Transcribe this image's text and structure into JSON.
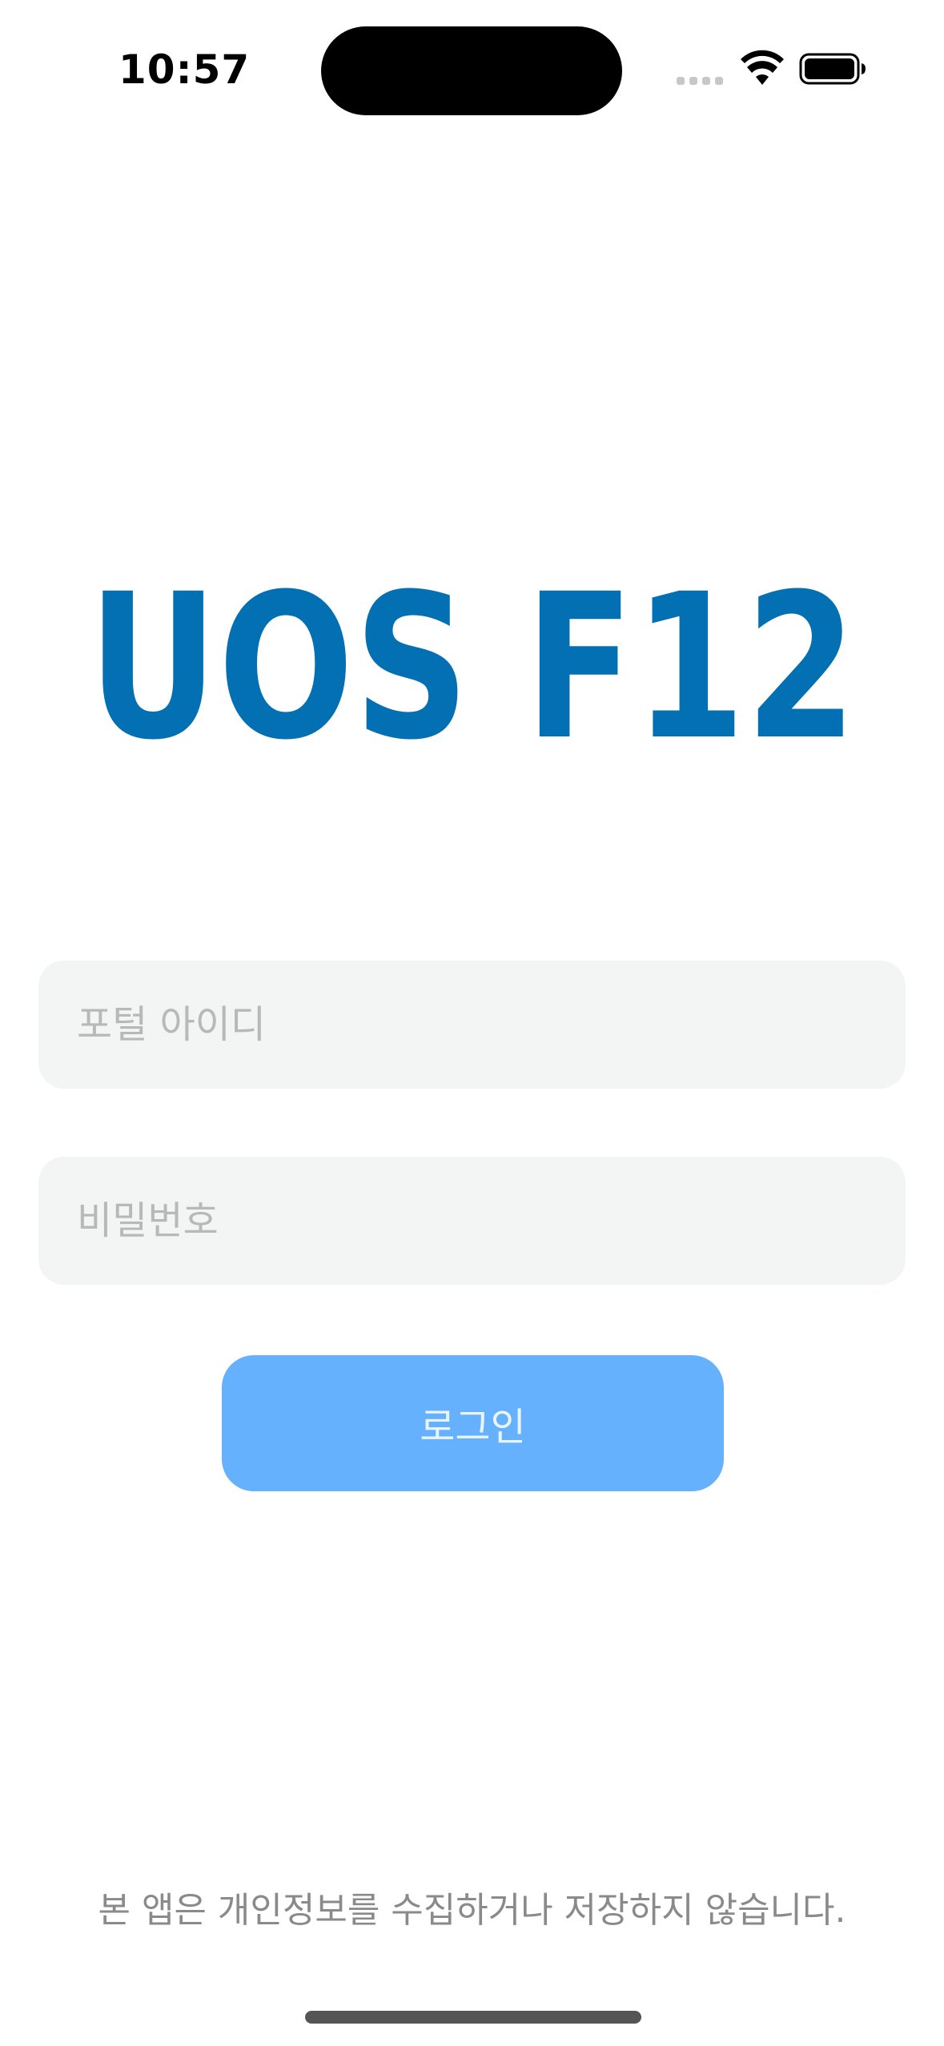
{
  "status_bar": {
    "time": "10:57",
    "icons": [
      "signal-icon",
      "wifi-icon",
      "battery-icon"
    ]
  },
  "logo": {
    "text": "UOS F12",
    "color": "#0270b2"
  },
  "login_form": {
    "id_placeholder": "포털 아이디",
    "id_value": "",
    "password_placeholder": "비밀번호",
    "password_value": "",
    "login_label": "로그인"
  },
  "footer": {
    "privacy_notice": "본 앱은 개인정보를 수집하거나 저장하지 않습니다."
  },
  "colors": {
    "accent": "#66b1fe",
    "field_background": "#f3f4f4",
    "placeholder": "#b8b8b8",
    "notice_text": "#8a8a8a"
  }
}
